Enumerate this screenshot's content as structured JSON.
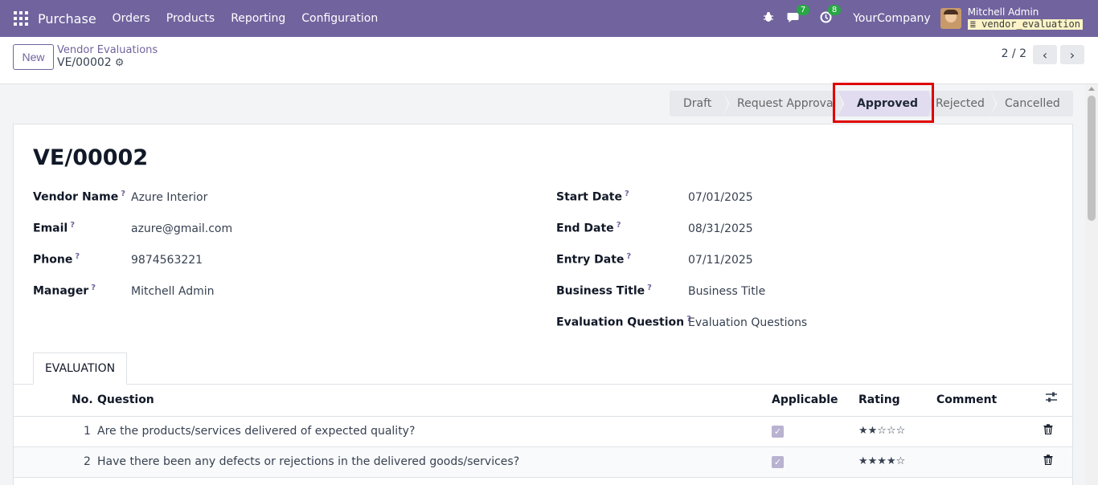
{
  "nav": {
    "app_name": "Purchase",
    "menu": [
      "Orders",
      "Products",
      "Reporting",
      "Configuration"
    ],
    "messages_count": "7",
    "activities_count": "8",
    "company": "YourCompany",
    "user_name": "Mitchell Admin",
    "database": "vendor_evaluation"
  },
  "control": {
    "new_label": "New",
    "breadcrumb": "Vendor Evaluations",
    "record_ref": "VE/00002",
    "pager": "2 / 2"
  },
  "status": {
    "stages": [
      "Draft",
      "Request Approval",
      "Approved",
      "Rejected",
      "Cancelled"
    ],
    "active": "Approved"
  },
  "record": {
    "title": "VE/00002",
    "left_fields": [
      {
        "label": "Vendor Name",
        "value": "Azure Interior"
      },
      {
        "label": "Email",
        "value": "azure@gmail.com"
      },
      {
        "label": "Phone",
        "value": "9874563221"
      },
      {
        "label": "Manager",
        "value": "Mitchell Admin"
      }
    ],
    "right_fields": [
      {
        "label": "Start Date",
        "value": "07/01/2025"
      },
      {
        "label": "End Date",
        "value": "08/31/2025"
      },
      {
        "label": "Entry Date",
        "value": "07/11/2025"
      },
      {
        "label": "Business Title",
        "value": "Business Title"
      },
      {
        "label": "Evaluation Question",
        "value": "Evaluation Questions"
      }
    ],
    "help_marker": "?"
  },
  "tab": {
    "label": "EVALUATION"
  },
  "table": {
    "headers": {
      "no": "No.",
      "question": "Question",
      "applicable": "Applicable",
      "rating": "Rating",
      "comment": "Comment"
    },
    "rows": [
      {
        "no": "1",
        "question": "Are the products/services delivered of expected quality?",
        "applicable": true,
        "rating": "★★☆☆☆",
        "comment": ""
      },
      {
        "no": "2",
        "question": "Have there been any defects or rejections in the delivered goods/services?",
        "applicable": true,
        "rating": "★★★★☆",
        "comment": ""
      }
    ]
  }
}
